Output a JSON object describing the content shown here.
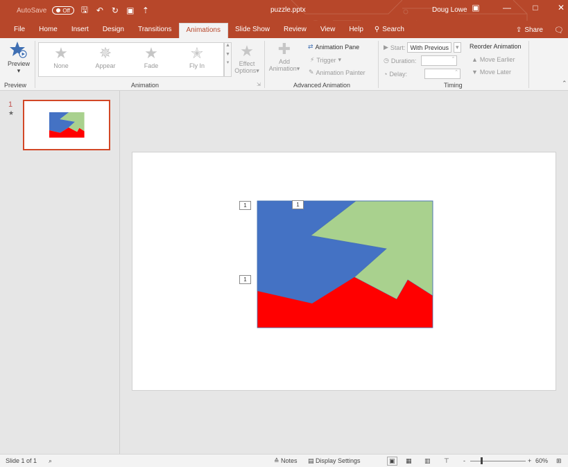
{
  "titlebar": {
    "autosave_label": "AutoSave",
    "autosave_state": "Off",
    "file_name": "puzzle.pptx",
    "user_name": "Doug Lowe",
    "accent_color": "#b7472a"
  },
  "tabs": {
    "items": [
      {
        "label": "File"
      },
      {
        "label": "Home"
      },
      {
        "label": "Insert"
      },
      {
        "label": "Design"
      },
      {
        "label": "Transitions"
      },
      {
        "label": "Animations"
      },
      {
        "label": "Slide Show"
      },
      {
        "label": "Review"
      },
      {
        "label": "View"
      },
      {
        "label": "Help"
      }
    ],
    "active": "Animations",
    "search_label": "Search",
    "share_label": "Share"
  },
  "ribbon": {
    "preview": {
      "button_label": "Preview",
      "group_label": "Preview"
    },
    "animation": {
      "group_label": "Animation",
      "gallery": [
        {
          "label": "None",
          "icon": "star-icon"
        },
        {
          "label": "Appear",
          "icon": "burst-star-icon"
        },
        {
          "label": "Fade",
          "icon": "star-icon"
        },
        {
          "label": "Fly In",
          "icon": "fly-star-icon"
        }
      ],
      "effect_options_line1": "Effect",
      "effect_options_line2": "Options"
    },
    "advanced": {
      "group_label": "Advanced Animation",
      "add_animation_line1": "Add",
      "add_animation_line2": "Animation",
      "animation_pane": "Animation Pane",
      "trigger": "Trigger",
      "animation_painter": "Animation Painter"
    },
    "timing": {
      "group_label": "Timing",
      "start_label": "Start:",
      "start_value": "With Previous",
      "duration_label": "Duration:",
      "delay_label": "Delay:",
      "reorder_title": "Reorder Animation",
      "move_earlier": "Move Earlier",
      "move_later": "Move Later"
    }
  },
  "slides_pane": {
    "slide_number": "1",
    "animation_marker": "★"
  },
  "canvas": {
    "anim_tags": [
      "1",
      "1",
      "1"
    ],
    "colors": {
      "blue": "#4472c4",
      "green": "#a9d18e",
      "red": "#ff0000"
    }
  },
  "statusbar": {
    "slide_info": "Slide 1 of 1",
    "notes_label": "Notes",
    "display_settings_label": "Display Settings",
    "zoom_minus": "-",
    "zoom_plus": "+",
    "zoom_level": "60%"
  }
}
